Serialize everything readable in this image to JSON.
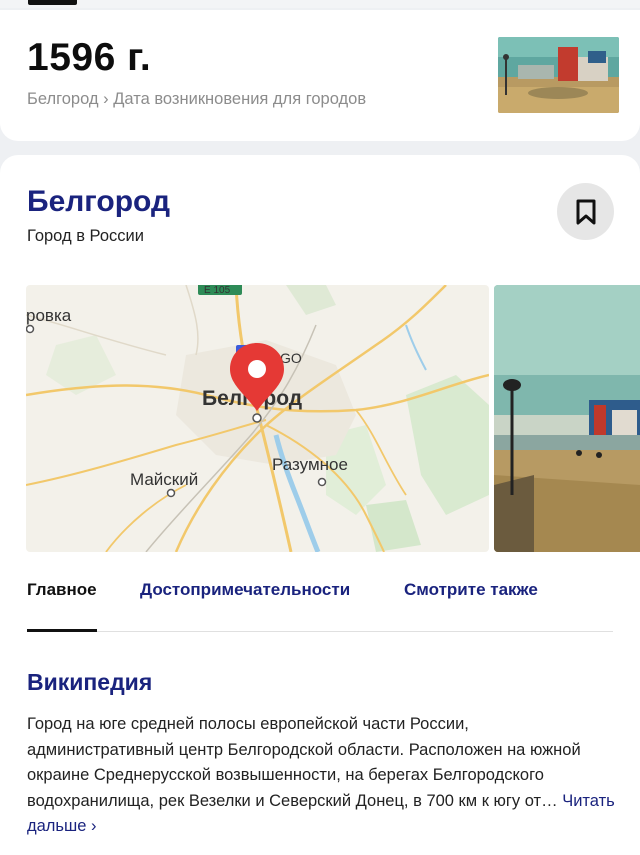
{
  "fact_card": {
    "value": "1596 г.",
    "breadcrumb_city": "Белгород",
    "breadcrumb_separator": "›",
    "breadcrumb_topic": "Дата возникновения для городов"
  },
  "entity_card": {
    "title": "Белгород",
    "subtitle": "Город в России",
    "bookmark_icon": "bookmark-icon",
    "map": {
      "labels": {
        "city": "Белгород",
        "left_top": "ровка",
        "mayskiy": "Майский",
        "razumnoe": "Разумное",
        "road_sign": "E 105",
        "transit": "GO"
      },
      "pin_color": "#e53935"
    }
  },
  "tabs": [
    {
      "label": "Главное",
      "active": true
    },
    {
      "label": "Достопримечательности",
      "active": false
    },
    {
      "label": "Смотрите также",
      "active": false
    }
  ],
  "wikipedia": {
    "heading": "Википедия",
    "text": "Город на юге средней полосы европейской части России, административный центр Белгородской области. Расположен на южной окраине Среднерусской возвышенности, на берегах Белгородского водохранилища, рек Везелки и Северский Донец, в 700 км к югу от…",
    "read_more": "Читать дальше ›"
  },
  "colors": {
    "link_blue": "#1a237e",
    "muted_gray": "#8c8c8c",
    "background": "#eef0f3"
  }
}
